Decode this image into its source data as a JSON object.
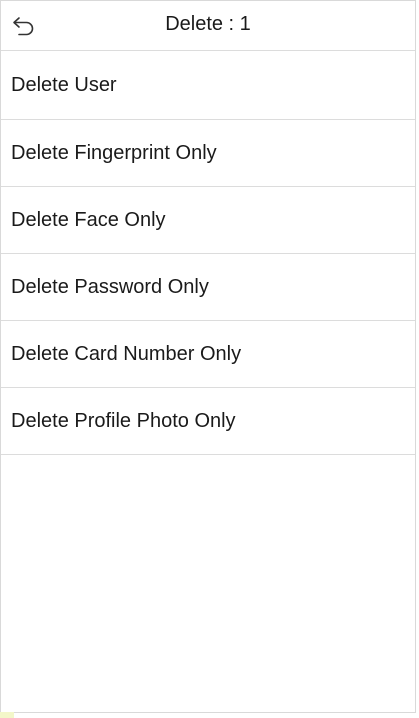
{
  "header": {
    "back_icon": "undo-arrow-icon",
    "title": "Delete : 1"
  },
  "menu": {
    "items": [
      {
        "label": "Delete User"
      },
      {
        "label": "Delete Fingerprint Only"
      },
      {
        "label": "Delete Face Only"
      },
      {
        "label": "Delete Password Only"
      },
      {
        "label": "Delete Card Number Only"
      },
      {
        "label": "Delete Profile Photo Only"
      }
    ]
  },
  "colors": {
    "text": "#1a1a1a",
    "divider": "#dcdcdc",
    "background": "#ffffff"
  }
}
